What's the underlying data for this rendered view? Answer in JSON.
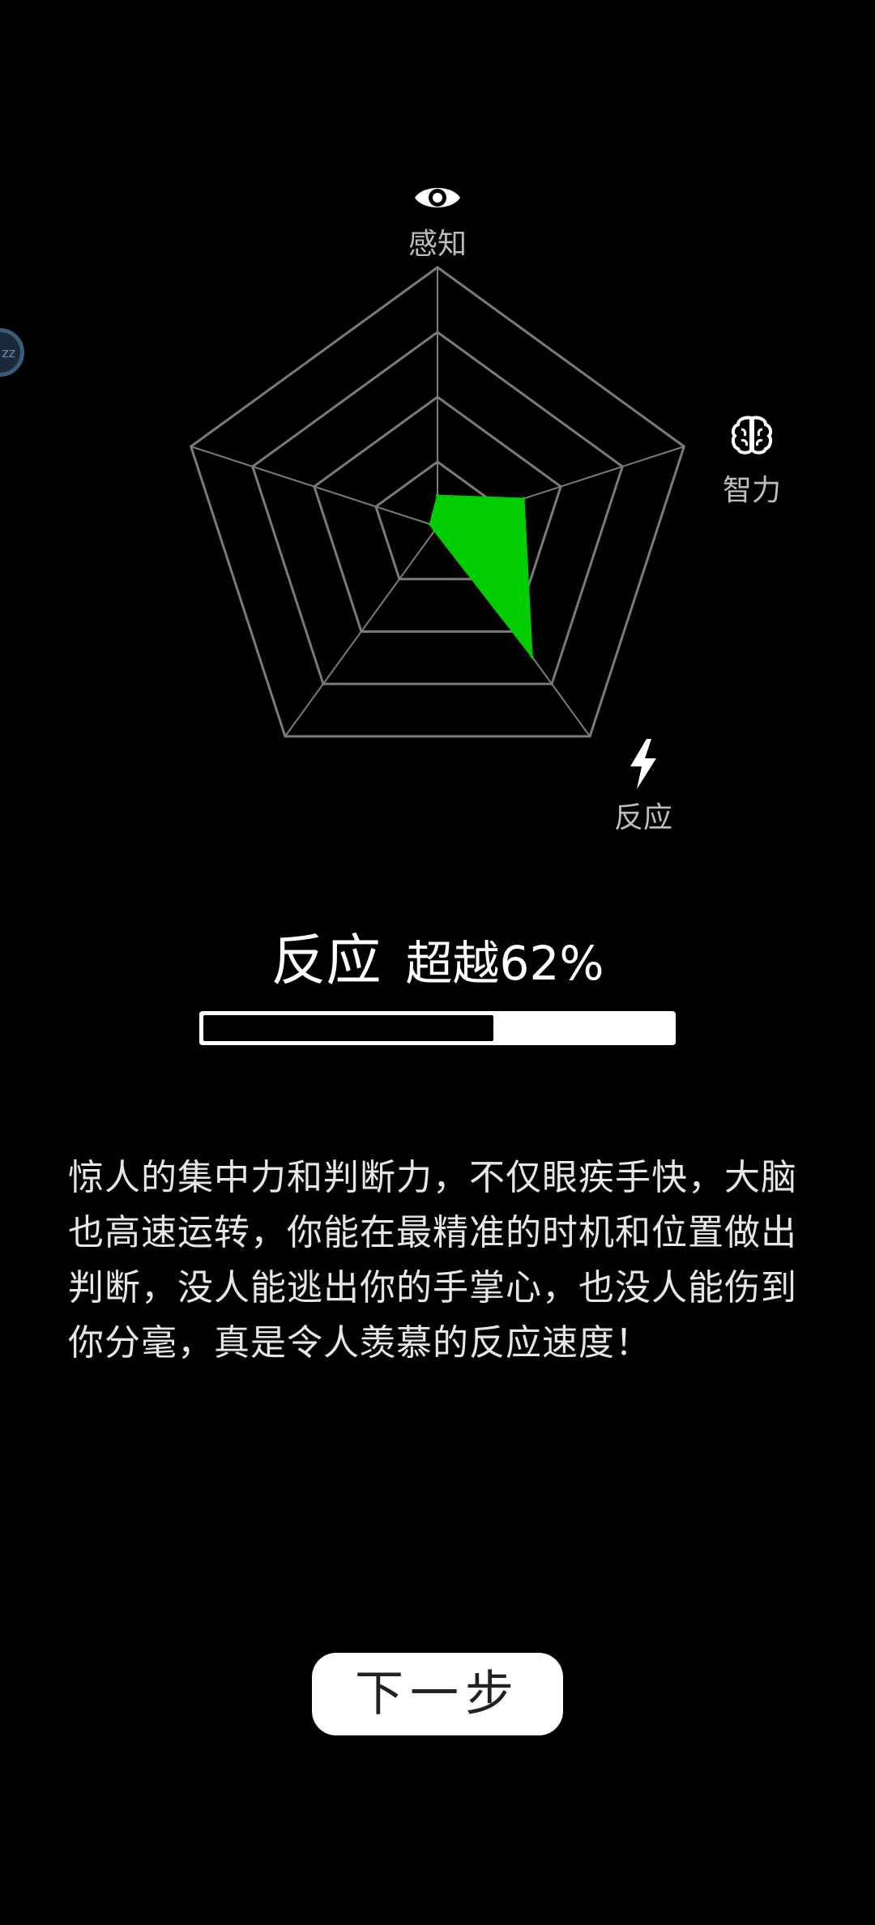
{
  "radar": {
    "axes": [
      {
        "label": "感知",
        "icon": "eye-icon",
        "value": 0.12
      },
      {
        "label": "智力",
        "icon": "brain-icon",
        "value": 0.35
      },
      {
        "label": "反应",
        "icon": "lightning-icon",
        "value": 0.62
      },
      {
        "label": "",
        "icon": "",
        "value": 0.02
      },
      {
        "label": "",
        "icon": "",
        "value": 0.03
      }
    ],
    "rings": 4,
    "fill_color": "#00cc00",
    "grid_color": "#7a7a7a"
  },
  "result": {
    "ability": "反应",
    "beat_text": "超越62%",
    "percent": 0.62
  },
  "description": "惊人的集中力和判断力，不仅眼疾手快，大脑也高速运转，你能在最精准的时机和位置做出判断，没人能逃出你的手掌心，也没人能伤到你分毫，真是令人羡慕的反应速度！",
  "next_button_label": "下一步",
  "floating_bubble_text": "zz"
}
